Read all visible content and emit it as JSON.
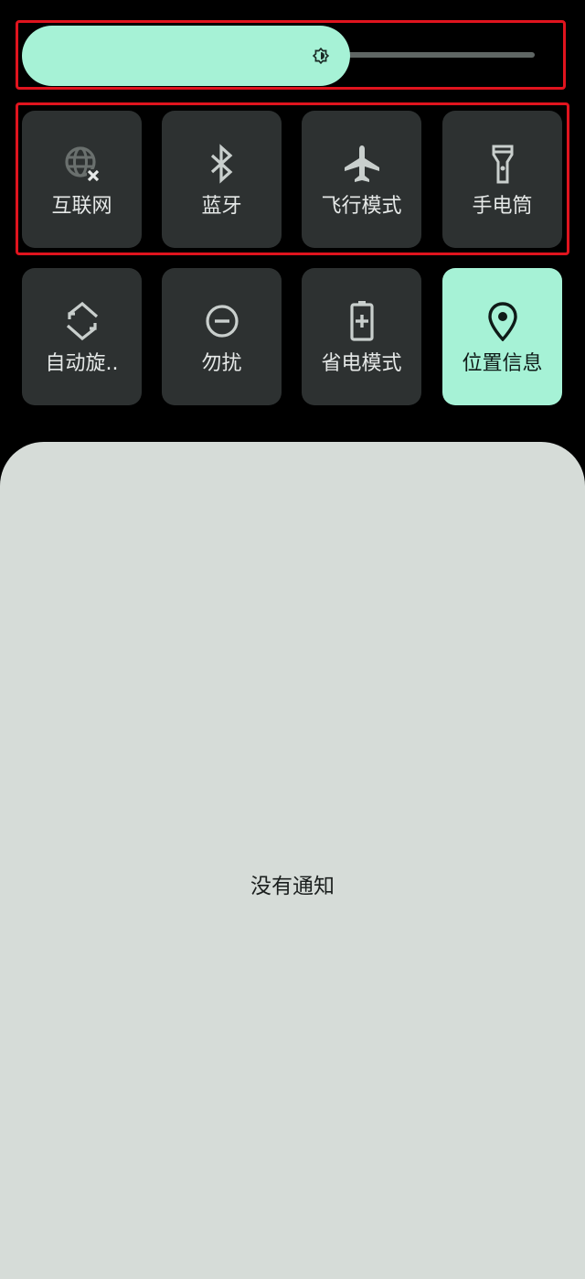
{
  "brightness": {
    "level_fraction": 0.64
  },
  "tiles_row1": [
    {
      "label": "互联网",
      "icon": "globe-off-icon",
      "active": false
    },
    {
      "label": "蓝牙",
      "icon": "bluetooth-icon",
      "active": false
    },
    {
      "label": "飞行模式",
      "icon": "airplane-icon",
      "active": false
    },
    {
      "label": "手电筒",
      "icon": "flashlight-icon",
      "active": false
    }
  ],
  "tiles_row2": [
    {
      "label": "自动旋..",
      "icon": "auto-rotate-icon",
      "active": false
    },
    {
      "label": "勿扰",
      "icon": "do-not-disturb-icon",
      "active": false
    },
    {
      "label": "省电模式",
      "icon": "battery-saver-icon",
      "active": false
    },
    {
      "label": "位置信息",
      "icon": "location-pin-icon",
      "active": true
    }
  ],
  "notifications": {
    "empty_text": "没有通知"
  },
  "colors": {
    "accent": "#a6f2d6",
    "tile_bg": "#2d3131",
    "panel_bg": "#d6dcd8",
    "highlight": "#e0141e"
  }
}
